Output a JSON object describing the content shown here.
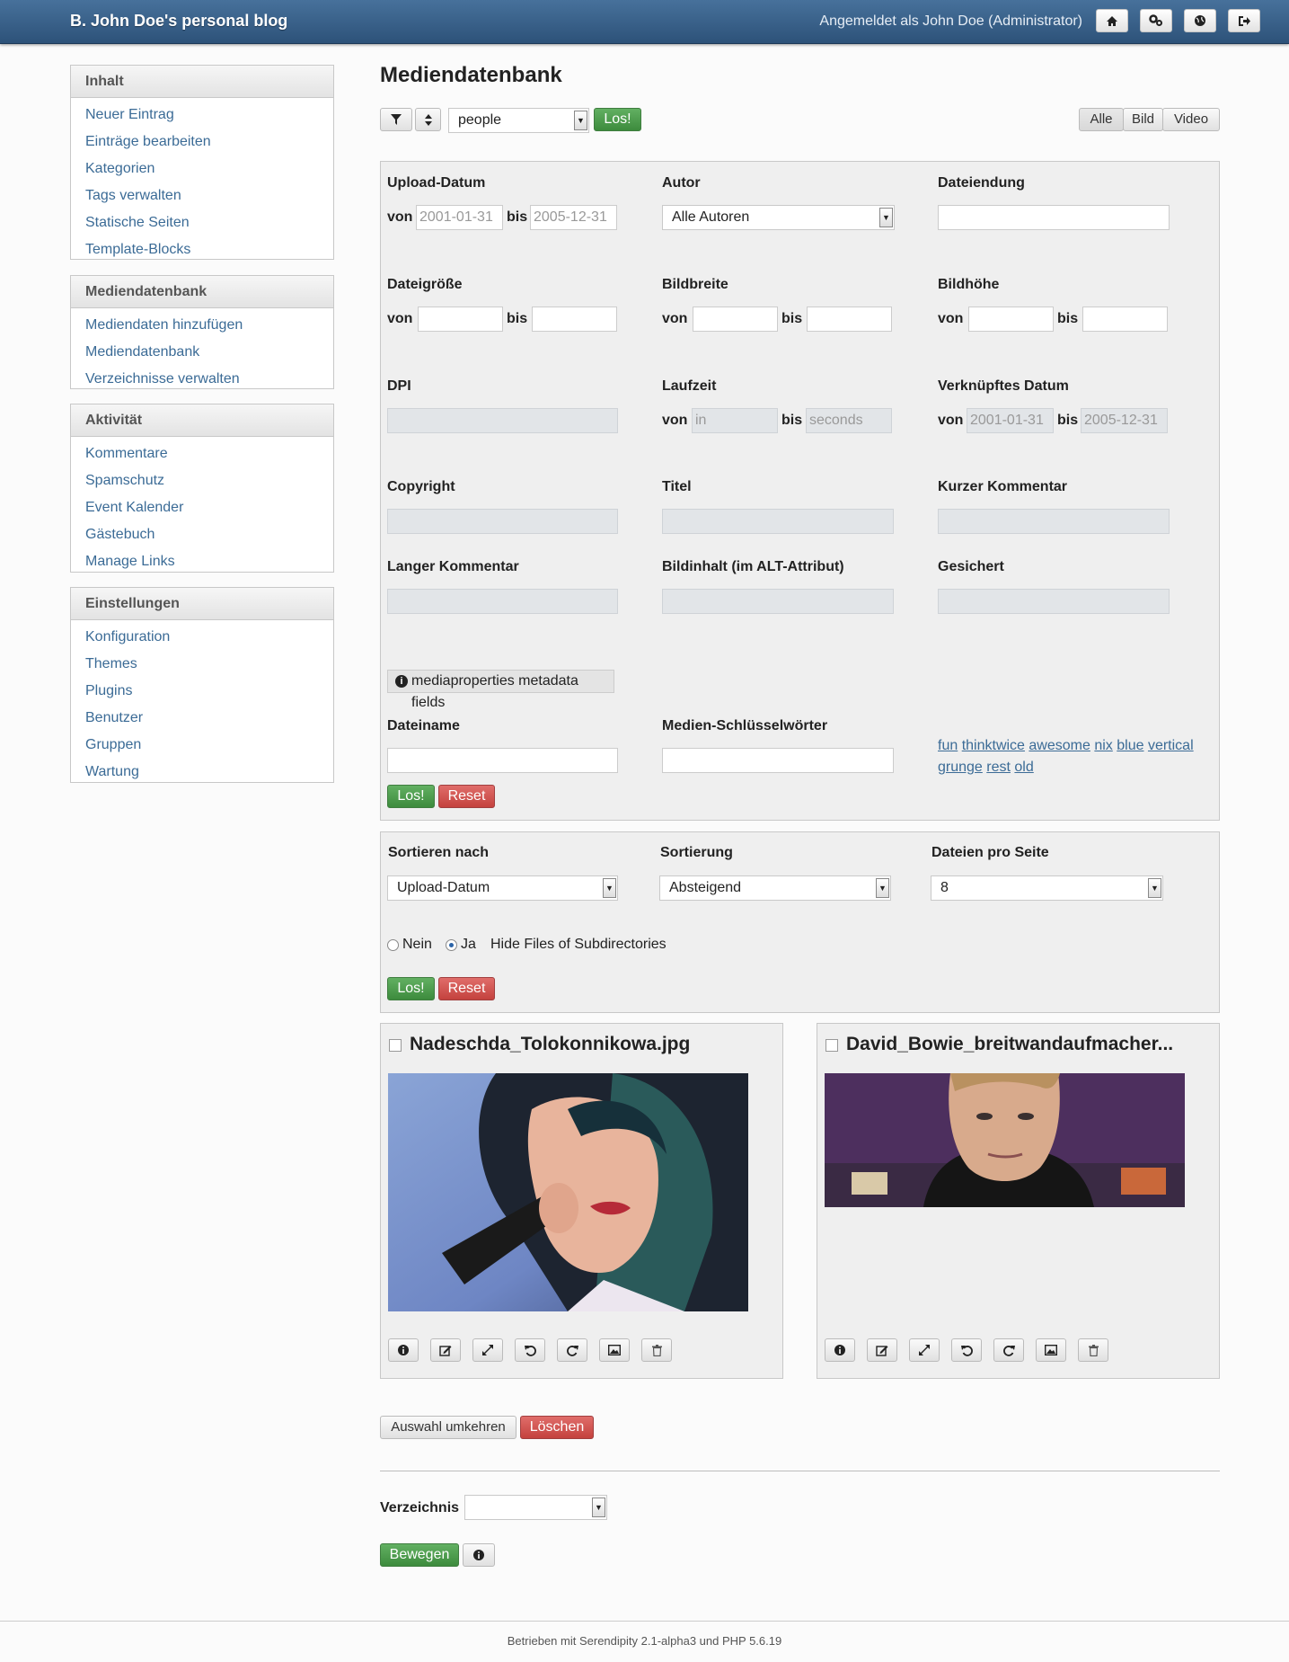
{
  "header": {
    "blog_title": "B. John Doe's personal blog",
    "login_info": "Angemeldet als John Doe (Administrator)",
    "icons": [
      "home-icon",
      "settings-icon",
      "globe-icon",
      "logout-icon"
    ]
  },
  "sidebar": [
    {
      "title": "Inhalt",
      "items": [
        "Neuer Eintrag",
        "Einträge bearbeiten",
        "Kategorien",
        "Tags verwalten",
        "Statische Seiten",
        "Template-Blocks"
      ]
    },
    {
      "title": "Mediendatenbank",
      "items": [
        "Mediendaten hinzufügen",
        "Mediendatenbank",
        "Verzeichnisse verwalten"
      ]
    },
    {
      "title": "Aktivität",
      "items": [
        "Kommentare",
        "Spamschutz",
        "Event Kalender",
        "Gästebuch",
        "Manage Links"
      ]
    },
    {
      "title": "Einstellungen",
      "items": [
        "Konfiguration",
        "Themes",
        "Plugins",
        "Benutzer",
        "Gruppen",
        "Wartung"
      ]
    }
  ],
  "main": {
    "title": "Mediendatenbank",
    "toolbar": {
      "directory_select": "people",
      "go_label": "Los!",
      "type_filters": [
        "Alle",
        "Bild",
        "Video"
      ],
      "active_type": "Alle"
    },
    "filters": {
      "upload_date": {
        "label": "Upload-Datum",
        "from_label": "von",
        "to_label": "bis",
        "from_placeholder": "2001-01-31",
        "to_placeholder": "2005-12-31"
      },
      "author": {
        "label": "Autor",
        "value": "Alle Autoren"
      },
      "extension": {
        "label": "Dateiendung"
      },
      "filesize": {
        "label": "Dateigröße",
        "from_label": "von",
        "to_label": "bis"
      },
      "width": {
        "label": "Bildbreite",
        "from_label": "von",
        "to_label": "bis"
      },
      "height": {
        "label": "Bildhöhe",
        "from_label": "von",
        "to_label": "bis"
      },
      "dpi": {
        "label": "DPI"
      },
      "runtime": {
        "label": "Laufzeit",
        "from_label": "von",
        "to_label": "bis",
        "from_placeholder": "in",
        "to_placeholder": "seconds"
      },
      "linked_date": {
        "label": "Verknüpftes Datum",
        "from_label": "von",
        "to_label": "bis",
        "from_placeholder": "2001-01-31",
        "to_placeholder": "2005-12-31"
      },
      "copyright": {
        "label": "Copyright"
      },
      "title": {
        "label": "Titel"
      },
      "short_comment": {
        "label": "Kurzer Kommentar"
      },
      "long_comment": {
        "label": "Langer Kommentar"
      },
      "alt": {
        "label": "Bildinhalt (im ALT-Attribut)"
      },
      "saved": {
        "label": "Gesichert"
      },
      "metadata_info": "mediaproperties metadata fields",
      "filename": {
        "label": "Dateiname"
      },
      "keywords": {
        "label": "Medien-Schlüsselwörter"
      },
      "tags": [
        "fun",
        "thinktwice",
        "awesome",
        "nix",
        "blue",
        "vertical",
        "grunge",
        "rest",
        "old"
      ],
      "go_label": "Los!",
      "reset_label": "Reset"
    },
    "sorting": {
      "sort_by_label": "Sortieren nach",
      "sort_by_value": "Upload-Datum",
      "order_label": "Sortierung",
      "order_value": "Absteigend",
      "per_page_label": "Dateien pro Seite",
      "per_page_value": "8",
      "radio_no": "Nein",
      "radio_yes": "Ja",
      "radio_selected": "Ja",
      "hide_subdirs_label": "Hide Files of Subdirectories",
      "go_label": "Los!",
      "reset_label": "Reset"
    },
    "files": [
      {
        "name": "Nadeschda_Tolokonnikowa.jpg"
      },
      {
        "name": "David_Bowie_breitwandaufmacher..."
      }
    ],
    "file_action_icons": [
      "info-icon",
      "edit-icon",
      "resize-icon",
      "rotate-ccw-icon",
      "rotate-cw-icon",
      "image-icon",
      "delete-icon"
    ],
    "bulk": {
      "invert_label": "Auswahl umkehren",
      "delete_label": "Löschen",
      "directory_label": "Verzeichnis",
      "directory_value": "",
      "move_label": "Bewegen"
    }
  },
  "footer": "Betrieben mit Serendipity 2.1-alpha3 und PHP 5.6.19",
  "colors": {
    "header": "#2d5279",
    "link": "#3b6b96",
    "go": "#4a9a4a",
    "reset": "#c9504c"
  }
}
